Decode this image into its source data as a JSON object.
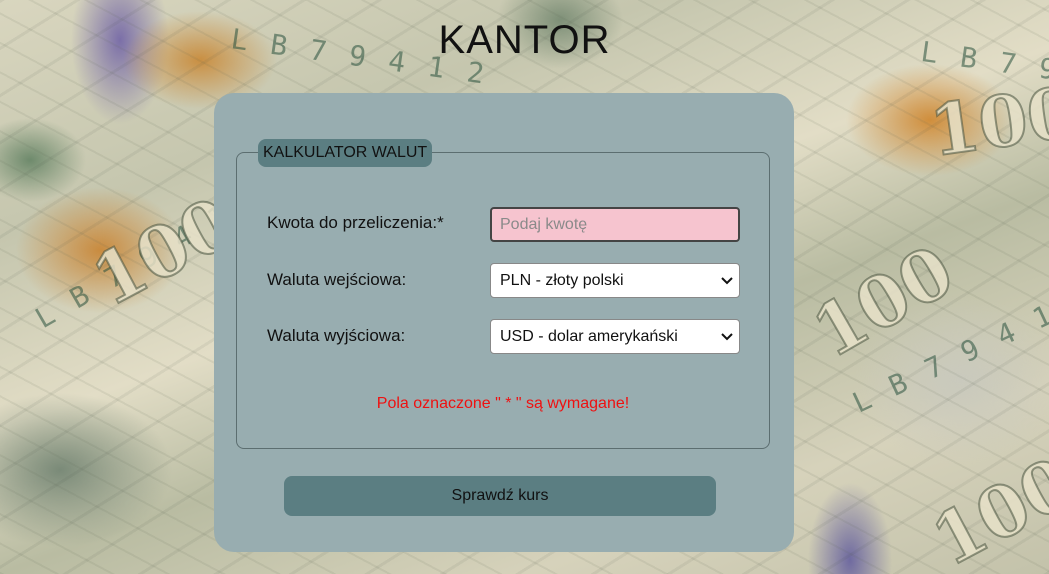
{
  "header": {
    "title": "KANTOR"
  },
  "calculator": {
    "legend": "KALKULATOR WALUT",
    "amount": {
      "label": "Kwota do przeliczenia:*",
      "value": "",
      "placeholder": "Podaj kwotę"
    },
    "input_currency": {
      "label": "Waluta wejściowa:",
      "selected": "PLN - złoty polski"
    },
    "output_currency": {
      "label": "Waluta wyjściowa:",
      "selected": "USD - dolar amerykański"
    },
    "required_note": "Pola oznaczone \" * \" są wymagane!",
    "submit_label": "Sprawdź kurs"
  },
  "icons": {
    "select_arrow": "chevron-down-icon"
  },
  "colors": {
    "panel": "#98adb0",
    "accent": "#5b7e82",
    "input_invalid": "#f6c4cf",
    "warning_text": "#ee1111"
  }
}
